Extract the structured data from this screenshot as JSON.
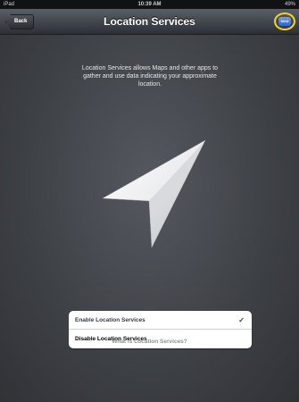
{
  "status_bar": {
    "carrier": "iPad",
    "time": "10:39 AM",
    "battery": "49%"
  },
  "nav": {
    "back_label": "Back",
    "title": "Location Services",
    "next_label": "Next"
  },
  "description": "Location Services allows Maps and other apps to gather and use data indicating your approximate location.",
  "options": [
    {
      "label": "Enable Location Services",
      "checkmark": "✓",
      "selected": true
    },
    {
      "label": "Disable Location Services",
      "selected": false
    }
  ],
  "link": "What is Location Services?",
  "colors": {
    "highlight_ring": "#f4d41a",
    "button_blue": "#2b63d8",
    "background": "#3f4247"
  },
  "icons": {
    "hero": "location-arrow-icon",
    "check": "checkmark-icon"
  }
}
